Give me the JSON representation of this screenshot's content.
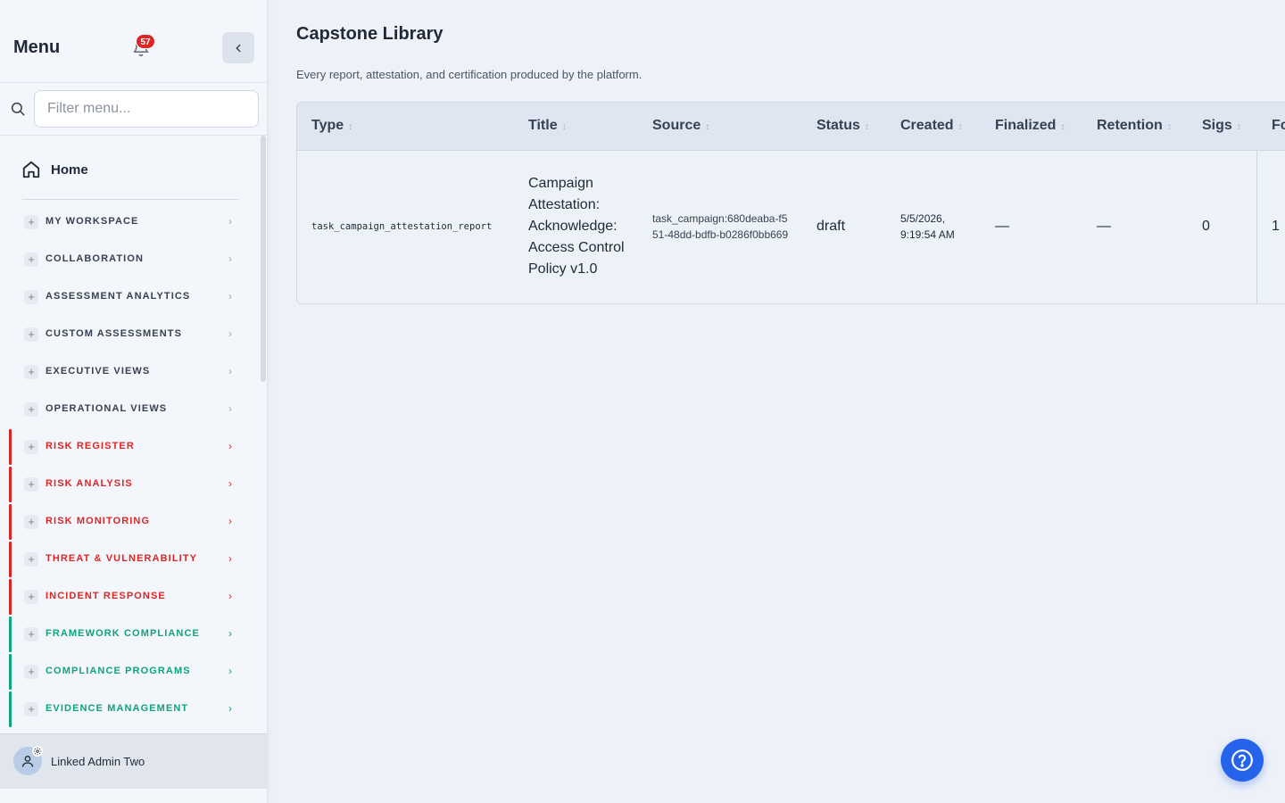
{
  "sidebar": {
    "title": "Menu",
    "notification_count": "57",
    "search_placeholder": "Filter menu...",
    "home_label": "Home",
    "items": [
      {
        "label": "My Workspace",
        "accent": ""
      },
      {
        "label": "Collaboration",
        "accent": ""
      },
      {
        "label": "Assessment Analytics",
        "accent": ""
      },
      {
        "label": "Custom Assessments",
        "accent": ""
      },
      {
        "label": "Executive Views",
        "accent": ""
      },
      {
        "label": "Operational Views",
        "accent": ""
      },
      {
        "label": "Risk Register",
        "accent": "#dc2626"
      },
      {
        "label": "Risk Analysis",
        "accent": "#dc2626"
      },
      {
        "label": "Risk Monitoring",
        "accent": "#dc2626"
      },
      {
        "label": "Threat & Vulnerability",
        "accent": "#dc2626"
      },
      {
        "label": "Incident Response",
        "accent": "#dc2626"
      },
      {
        "label": "Framework Compliance",
        "accent": "#10a37f"
      },
      {
        "label": "Compliance Programs",
        "accent": "#10a37f"
      },
      {
        "label": "Evidence Management",
        "accent": "#10a37f"
      }
    ],
    "user_name": "Linked Admin Two"
  },
  "main": {
    "title": "Capstone Library",
    "subtitle": "Every report, attestation, and certification produced by the platform.",
    "table": {
      "columns": [
        "Type",
        "Title",
        "Source",
        "Status",
        "Created",
        "Finalized",
        "Retention",
        "Sigs",
        "Fo"
      ],
      "rows": [
        {
          "type": "task_campaign_attestation_report",
          "title": "Campaign Attestation: Acknowledge: Access Control Policy v1.0",
          "source": "task_campaign:680deaba-f551-48dd-bdfb-b0286f0bb669",
          "status": "draft",
          "created": "5/5/2026, 9:19:54 AM",
          "finalized": "—",
          "retention": "—",
          "sigs": "0",
          "fo": "1"
        }
      ]
    }
  },
  "colors": {
    "risk_accent": "#dc2626",
    "compliance_accent": "#10a37f",
    "primary": "#2563eb",
    "badge": "#dc2626"
  },
  "icons": [
    "bell-icon",
    "chevron-left-icon",
    "search-icon",
    "home-icon",
    "plus-icon",
    "chevron-right-icon",
    "user-icon",
    "gear-icon",
    "help-icon"
  ]
}
